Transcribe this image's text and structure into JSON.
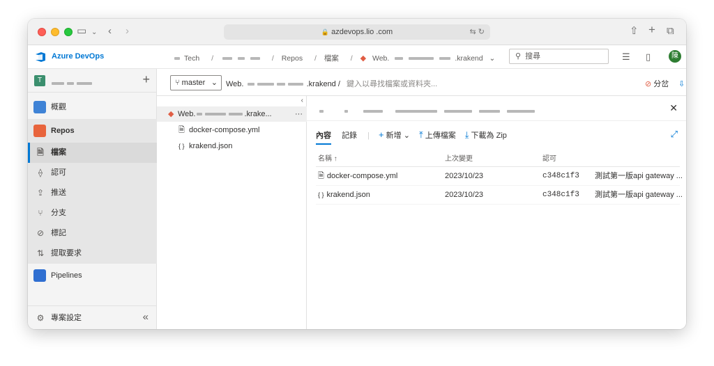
{
  "browser": {
    "url": "azdevops.lio     .com",
    "icons": [
      "sidebar-icon",
      "back-icon",
      "forward-icon",
      "share-icon",
      "new-tab-icon",
      "tabs-icon"
    ]
  },
  "header": {
    "brand": "Azure DevOps",
    "crumbs": [
      "Tech",
      "Repos",
      "檔案",
      "Web.",
      ".krakend"
    ],
    "search_placeholder": "搜尋",
    "avatar_text": "陳"
  },
  "sidebar": {
    "project_badge": "T",
    "overview": "概觀",
    "repos": "Repos",
    "repo_items": [
      {
        "label": "檔案",
        "icon": "file-icon",
        "glyph": "🗎"
      },
      {
        "label": "認可",
        "icon": "commit-icon",
        "glyph": "⟠"
      },
      {
        "label": "推送",
        "icon": "push-icon",
        "glyph": "⇪"
      },
      {
        "label": "分支",
        "icon": "branch-icon",
        "glyph": "⑂"
      },
      {
        "label": "標記",
        "icon": "tag-icon",
        "glyph": "⊘"
      },
      {
        "label": "提取要求",
        "icon": "pull-request-icon",
        "glyph": "⇅"
      }
    ],
    "pipelines": "Pipelines",
    "settings": "專案設定"
  },
  "toolbar": {
    "branch": "master",
    "path_prefix": "Web.",
    "path_suffix": ".krakend",
    "path_sep": "/",
    "path_placeholder": "鍵入以尋找檔案或資料夾...",
    "fork_label": "分岔",
    "clone_label": "複製"
  },
  "tree": {
    "root_prefix": "Web.",
    "root_suffix": ".krake...",
    "more": "···",
    "files": [
      {
        "name": "docker-compose.yml",
        "icon": "file-icon"
      },
      {
        "name": "krakend.json",
        "icon": "json-icon"
      }
    ]
  },
  "content": {
    "tabs": [
      "內容",
      "記錄"
    ],
    "new_label": "新增",
    "upload_label": "上傳檔案",
    "download_label": "下載為 Zip",
    "columns": [
      "名稱 ↑",
      "上次變更",
      "認可"
    ],
    "rows": [
      {
        "name": "docker-compose.yml",
        "date": "2023/10/23",
        "commit": "c348c1f3",
        "message": "測試第一版api gateway ..."
      },
      {
        "name": "krakend.json",
        "date": "2023/10/23",
        "commit": "c348c1f3",
        "message": "測試第一版api gateway ..."
      }
    ]
  }
}
